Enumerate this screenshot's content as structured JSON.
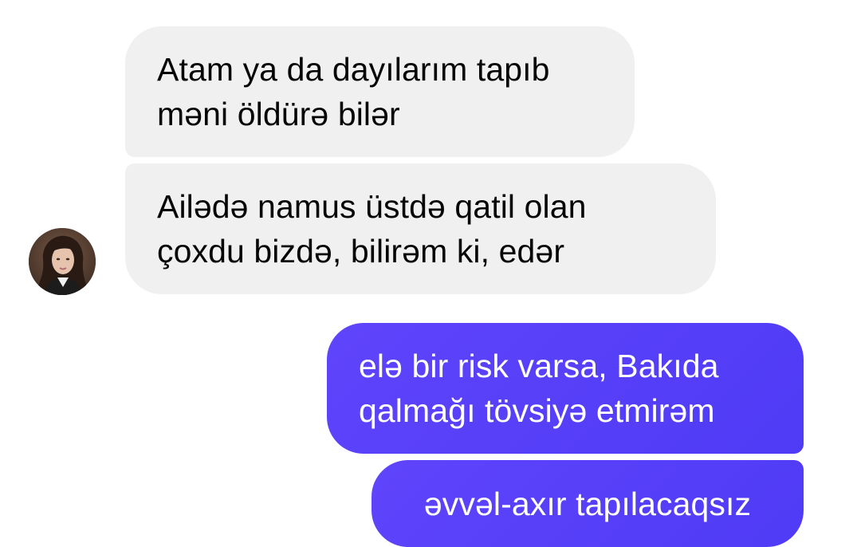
{
  "messages": {
    "incoming": [
      {
        "lines": [
          "Atam ya da dayılarım tapıb",
          "məni öldürə bilər"
        ]
      },
      {
        "lines": [
          "Ailədə namus üstdə qatil olan",
          "çoxdu bizdə, bilirəm ki, edər"
        ]
      }
    ],
    "outgoing": [
      {
        "lines": [
          "elə bir risk varsa, Bakıda",
          "qalmağı tövsiyə etmirəm"
        ]
      },
      {
        "lines": [
          "əvvəl-axır tapılacaqsız"
        ]
      }
    ]
  },
  "colors": {
    "incoming_bubble": "#f0f0f0",
    "incoming_text": "#050505",
    "outgoing_bubble": "#5b3dfa",
    "outgoing_text": "#ffffff",
    "background": "#ffffff"
  },
  "icons": {
    "contact_avatar": "contact-avatar"
  }
}
